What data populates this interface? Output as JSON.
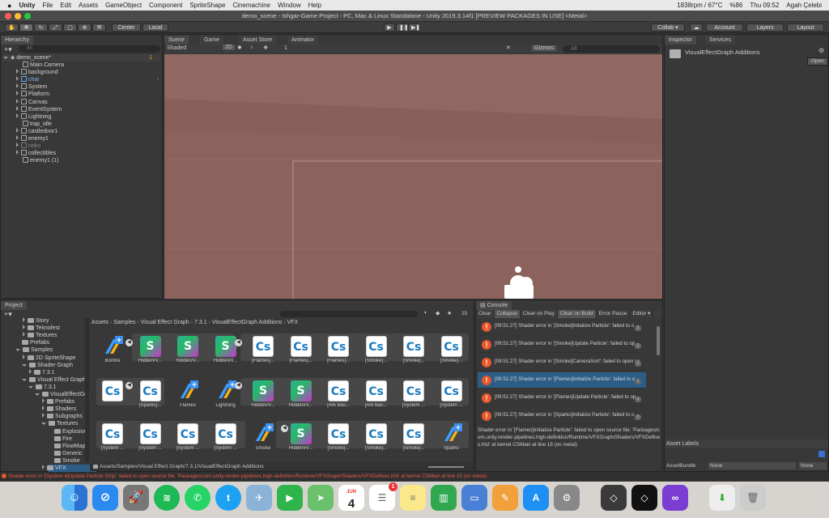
{
  "menubar": {
    "app": "Unity",
    "items": [
      "File",
      "Edit",
      "Assets",
      "GameObject",
      "Component",
      "SpriteShape",
      "Cinemachine",
      "Window",
      "Help"
    ],
    "status": "1838rpm / 67°C",
    "battery": "%86",
    "clock": "Thu 09:52",
    "user": "Agah Çelebi"
  },
  "window_title": "demo_scene - Ishgar-Game Project - PC, Mac & Linux Standalone - Unity 2019.3.14f1 [PREVIEW PACKAGES IN USE] <Metal>",
  "toolbar": {
    "center": "Center",
    "local": "Local",
    "collab": "Collab ▾",
    "account": "Account",
    "layers": "Layers",
    "layout": "Layout"
  },
  "hierarchy": {
    "tab": "Hierarchy",
    "search_placeholder": "All",
    "scene": "demo_scene*",
    "scene_count": "1",
    "items": [
      "Main Camera",
      "background",
      "char",
      "System",
      "Platform",
      "Canvas",
      "EventSystem",
      "Lightning",
      "trap_idle",
      "castledoor1",
      "enemy1",
      "neko",
      "collectibles",
      "enemy1 (1)"
    ]
  },
  "scene_tabs": [
    "Scene",
    "Game",
    "Asset Store",
    "Animator"
  ],
  "scene_toolbar": {
    "shading": "Shaded",
    "mode2d": "2D",
    "layers": "1",
    "gizmos": "Gizmos",
    "search": "All"
  },
  "project": {
    "tab": "Project",
    "tree": [
      "Story",
      "Teknofest",
      "Textures",
      "Prefabs",
      "Samples",
      "2D SpriteShape",
      "Shader Graph",
      "7.3.1",
      "Visual Effect Graph",
      "7.3.1",
      "VisualEffectGra",
      "Prefabs",
      "Shaders",
      "Subgraphs",
      "Textures",
      "Explosion",
      "Fire",
      "FlowMaps",
      "Generic",
      "Smoke",
      "VFX"
    ],
    "breadcrumb": [
      "Assets",
      "Samples",
      "Visual Effect Graph",
      "7.3.1",
      "VisualEffectGraph Additions",
      "VFX"
    ],
    "count": "25",
    "path": "Assets/Samples/Visual Effect Graph/7.3.1/VisualEffectGraph Additions",
    "row1": [
      {
        "n": "Bonfire",
        "t": "vfx"
      },
      {
        "n": "Hidden/V...",
        "t": "sh"
      },
      {
        "n": "Hidden/V...",
        "t": "sh"
      },
      {
        "n": "Hidden/V...",
        "t": "sh"
      },
      {
        "n": "[Flames]...",
        "t": "cs"
      },
      {
        "n": "[Flames]...",
        "t": "cs"
      },
      {
        "n": "[Flames]...",
        "t": "cs"
      },
      {
        "n": "[Smoke]...",
        "t": "cs"
      },
      {
        "n": "[Smoke]...",
        "t": "cs"
      },
      {
        "n": "[Smoke]...",
        "t": "cs"
      }
    ],
    "row2": [
      {
        "n": "",
        "t": "cs"
      },
      {
        "n": "[Sparks]...",
        "t": "cs"
      },
      {
        "n": "Flames",
        "t": "vfx"
      },
      {
        "n": "Lightning",
        "t": "vfx"
      },
      {
        "n": "Hidden/V...",
        "t": "sh"
      },
      {
        "n": "Hidden/V...",
        "t": "sh"
      },
      {
        "n": "[Ark Bas...",
        "t": "cs"
      },
      {
        "n": "[Ark Bas...",
        "t": "cs"
      },
      {
        "n": "[System ...",
        "t": "cs"
      },
      {
        "n": "[System ...",
        "t": "cs"
      }
    ],
    "row3": [
      {
        "n": "[System ...",
        "t": "cs"
      },
      {
        "n": "[System ...",
        "t": "cs"
      },
      {
        "n": "[System ...",
        "t": "cs"
      },
      {
        "n": "[System ...",
        "t": "cs"
      },
      {
        "n": "Smoke",
        "t": "vfx"
      },
      {
        "n": "Hidden/V...",
        "t": "sh"
      },
      {
        "n": "[Smoke]...",
        "t": "cs"
      },
      {
        "n": "[Smoke]...",
        "t": "cs"
      },
      {
        "n": "[Smoke]...",
        "t": "cs"
      },
      {
        "n": "Sparks",
        "t": "vfx"
      }
    ]
  },
  "console": {
    "tab": "Console",
    "buttons": [
      "Clear",
      "Collapse",
      "Clear on Play",
      "Clear on Build",
      "Error Pause",
      "Editor ▾"
    ],
    "entries": [
      "[09:51:27] Shader error in '[Smoke]Initialize Particle': failed to o",
      "[09:51:27] Shader error in '[Smoke]Update Particle': failed to op",
      "[09:51:27] Shader error in '[Smoke]CameraSort': failed to open so",
      "[09:51:27] Shader error in '[Flames]Initialize Particle': failed to o",
      "[09:51:27] Shader error in '[Flames]Update Particle': failed to op",
      "[09:51:27] Shader error in '[Sparks]Initialize Particle': failed to o"
    ],
    "counts": [
      "1",
      "1",
      "1",
      "1",
      "1",
      "1"
    ],
    "detail": "Shader error in '[Flames]Initialize Particle': failed to open source file: 'Packages/com.unity.render-pipelines.high-definition/Runtime/VFXGraph/Shaders/VFXDefines.hlsl' at kernel CSMain at line 18 (on metal)"
  },
  "inspector": {
    "tabs": [
      "Inspector",
      "Services"
    ],
    "title": "VisualEffectGraph Additions",
    "open": "Open",
    "labels": "Asset Labels",
    "bundle_label": "AssetBundle",
    "bundle": "None",
    "variant": "None"
  },
  "status_error": "Shader error in '[System 4]Update Particle Strip': failed to open source file: 'Packages/com.unity.render-pipelines.high-definition/Runtime/VFXGraph/Shaders/VFXDefines.hlsl' at kernel CSMain at line 15 (on metal)",
  "dock": {
    "calendar_month": "JUN",
    "calendar_day": "4",
    "reminders_badge": "1"
  }
}
